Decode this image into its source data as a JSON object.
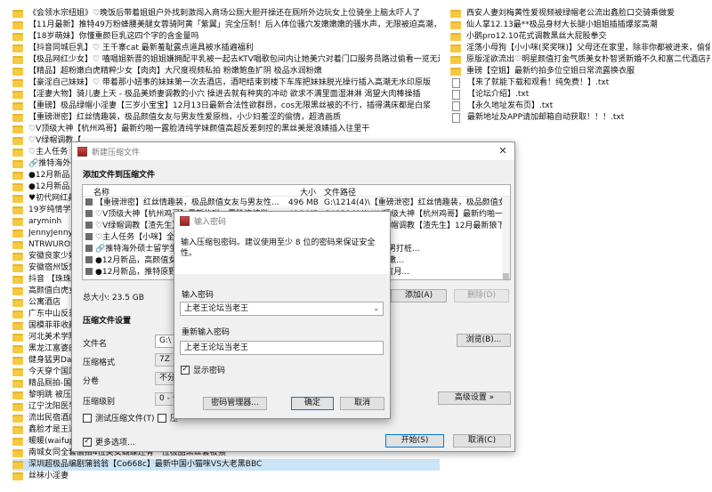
{
  "explorer": {
    "left_items": [
      {
        "type": "folder",
        "name": "《会领水宗纽姐》♡晚饭后带着姐姐户外找刺激闯入商场公厕大胆开操还在厕所外边玩女上位骑坐上脑太吓人了"
      },
      {
        "type": "folder",
        "name": "【11月最新】推特49万粉蜂腰美腿女蓉骑阿黄「紫翼」完全压制！后入体位骚穴发嫩嫩嫩的骚水声，无限被迫高潮，双腿被操到颤抖！"
      },
      {
        "type": "folder",
        "name": "【18岁萌妹】你懂重颜巨乳这四个字的含金量吗"
      },
      {
        "type": "folder",
        "name": "【抖音同城巨乳】♡ 王千寨cat 最新羞耻露点道具被水插遍福利"
      },
      {
        "type": "folder",
        "name": "【极品网红少女】♡ 嗑唱姐新晋的姐姐嫌拥配平乳被一起去KTV唱歌包间内让她美穴对着门口服务员路过偷看一览无遗骚穴湿印版"
      },
      {
        "type": "folder",
        "name": "【精品】超粉嫩白虎精粹少女【肉肉】大尺度视频私拍 粉嫩鲍鱼扩阴 极品水润粉嫩"
      },
      {
        "type": "folder",
        "name": "【豪淫自己妹妹】♡ 带着那小妞事的妹妹第一次去酒店，酒吧结束到楼下车库把妹妹脱光操行插入高潮无水印原版"
      },
      {
        "type": "folder",
        "name": "【淫妻大物】骑儿妻上天 - 极品美娇妻调教的小穴 操进去就有种爽的冲动 欲求不满里面湿淋淋 渴望大肉棒操插"
      },
      {
        "type": "folder",
        "name": "【重磅】极品绿帽小淫妻【三岁小宝宝】12月13日最新合法性欲群昂，cos无限黑丝被的不行，插得满床都是白浆"
      },
      {
        "type": "folder",
        "name": "【重磅泄密】红丝情趣装，极品颜值女友与男友性爱原档，小少妇羞涩的偷情，超清画质"
      },
      {
        "type": "folder",
        "name": "♡V顶级大神【杭州鸡哥】最新约啪一露脸清纯学妹颜值高超反差刺控的黑丝美是浪婊插入往里干"
      },
      {
        "type": "folder",
        "name": "♡V绿帽调教【"
      },
      {
        "type": "folder",
        "name": "♡主人任务【小咪"
      },
      {
        "type": "folder",
        "name": "🔗推特海外硕士留"
      },
      {
        "type": "folder",
        "name": "●12月新品，高颜"
      },
      {
        "type": "folder",
        "name": "●12月新品，推特"
      },
      {
        "type": "folder",
        "name": "♥初代网红鼻祖、"
      },
      {
        "type": "folder",
        "name": "19岁纯情学生【小"
      },
      {
        "type": "folder",
        "name": "aryminh"
      },
      {
        "type": "folder",
        "name": "JennyJenny08261"
      },
      {
        "type": "folder",
        "name": "NTRWUROSE(ROS"
      },
      {
        "type": "folder",
        "name": "安徽良家少妇 卿卿"
      },
      {
        "type": "folder",
        "name": "安徽宿州饭爱酒店"
      },
      {
        "type": "folder",
        "name": "抖音 【珠珠炭烤】"
      },
      {
        "type": "folder",
        "name": "高颜值白虎女神Pa"
      },
      {
        "type": "folder",
        "name": "公寓酒店"
      },
      {
        "type": "folder",
        "name": "广东中山反差骚婊"
      },
      {
        "type": "folder",
        "name": "国模菲菲收藏版"
      },
      {
        "type": "folder",
        "name": "河北美术学院学生"
      },
      {
        "type": "folder",
        "name": "黑龙江富婆肉夫妻"
      },
      {
        "type": "folder",
        "name": "健身猛男Darklate"
      },
      {
        "type": "folder",
        "name": "今天穿个国风情趣"
      },
      {
        "type": "folder",
        "name": "精品厕拍-国内商场"
      },
      {
        "type": "folder",
        "name": "黎明跳 被压在桌子"
      },
      {
        "type": "folder",
        "name": "辽宁沈阳医学院 H"
      },
      {
        "type": "folder",
        "name": "流出民宿酒店偷拍"
      },
      {
        "type": "folder",
        "name": "鑫脸才是王道 超萌"
      },
      {
        "type": "folder",
        "name": "暖暖(waifupupu)12月定制新作 滑滑蕾丝眼罩白丝 大长腿玉足配上口舌粉鲍"
      },
      {
        "type": "folder",
        "name": "南城女同全套偷拍4位美女蝴蝶还有一位极品黑丝套被猥"
      },
      {
        "type": "folder",
        "name": "深圳超极品编剧蒲翁翁【Co668c】最新中国小猫咪VS大老黑BBC"
      },
      {
        "type": "folder",
        "name": "丝袜小淫妻"
      }
    ],
    "selected_left_index": 39,
    "right_items": [
      {
        "type": "folder",
        "name": "西安人妻刘梅黄性爱视频被绿帽老公流出鑫脸口交骑乘做爱"
      },
      {
        "type": "folder",
        "name": "仙人掌12.13最**极品身材大长腿小姐姐插插爆浆高潮"
      },
      {
        "type": "folder",
        "name": "小鹅pro12.10花式调教黑丝大屁股拳交"
      },
      {
        "type": "folder",
        "name": "淫荡小母狗【小小咪(奖奖咪)】父母还在家里，除非你都被进来，偷偷给你操一把。伦超"
      },
      {
        "type": "folder",
        "name": "原版淫欲流出♡明星颜值打金气质美女朴智贤新婚不久和富二代酒店开房偷情视频"
      },
      {
        "type": "folder",
        "name": "重磅【空姐】最新约拍多位空姐日常流露换衣服"
      },
      {
        "type": "file",
        "name": "【来了就能下载和观看！纯免费！】.txt"
      },
      {
        "type": "file",
        "name": "【论坛介绍】.txt"
      },
      {
        "type": "file",
        "name": "【永久地址发布页】.txt"
      },
      {
        "type": "file",
        "name": "最新地址及APP请加邮箱自动获取！！！.txt"
      }
    ]
  },
  "main_dialog": {
    "title": "新建压缩文件",
    "section_add_title": "添加文件到压缩文件",
    "columns": {
      "name": "名称",
      "size": "大小",
      "path": "文件路径"
    },
    "rows": [
      {
        "name": "【重磅泄密】红丝情趣装，极品颜值女友与男友性...",
        "size": "496 MB",
        "path": "G:\\1214(4)\\【重磅泄密】红丝情趣装，极品颜值女..."
      },
      {
        "name": "♡V顶级大神【杭州鸡哥】最新约啪一露脸清纯学...",
        "size": "496 MB",
        "path": "G:\\1214(4)\\♡V顶级大神【杭州鸡哥】最新约啪一..."
      },
      {
        "name": "♡V绿帽调教【渣先生】12月最新狼喝出来...",
        "size": "496 MB",
        "path": "G:\\1214(4)\\♡V绿帽调教【渣先生】12月最新狼下..."
      },
      {
        "name": "♡主人任务【小咪】全裸",
        "size": "",
        "path": "金裸坐出租车 换..."
      },
      {
        "name": "🔗推特海外硕士留学生，长",
        "size": "",
        "path": "士留学生，长腿猛男打桩..."
      },
      {
        "name": "●12月新品，高颜值女导",
        "size": "",
        "path": "高颜值女警萝莉嫩嫩..."
      },
      {
        "name": "●12月新品，推特原野超",
        "size": "",
        "path": "推特原野超淫激泛 [月..."
      }
    ],
    "total_size": "总大小: 23.5 GB",
    "add_btn": "添加(A)",
    "delete_btn": "删除(D)",
    "section_settings_title": "压缩文件设置",
    "label_filename": "文件名",
    "filename_value": "G:\\",
    "browse_btn": "浏览(B)...",
    "label_format": "压缩格式",
    "format_value": "7Z",
    "label_volume": "分卷",
    "volume_value": "不分",
    "label_level": "压缩级别",
    "level_value": "0 - 仅",
    "test_label": "测试压缩文件(T)",
    "second_check_label": "压",
    "advanced_btn": "高级设置 »",
    "more_options_label": "更多选项...",
    "start_btn": "开始(S)",
    "cancel_btn": "取消(C)"
  },
  "password_dialog": {
    "title": "输入密码",
    "message": "输入压缩包密码。建议使用至少 8 位的密码来保证安全性。",
    "label_password": "输入密码",
    "password_value": "上老王论坛当老王",
    "label_confirm": "重新输入密码",
    "confirm_value": "上老王论坛当老王",
    "show_password_label": "显示密码",
    "show_password_checked": true,
    "manager_btn": "密码管理器...",
    "ok_btn": "确定",
    "cancel_btn": "取消"
  }
}
